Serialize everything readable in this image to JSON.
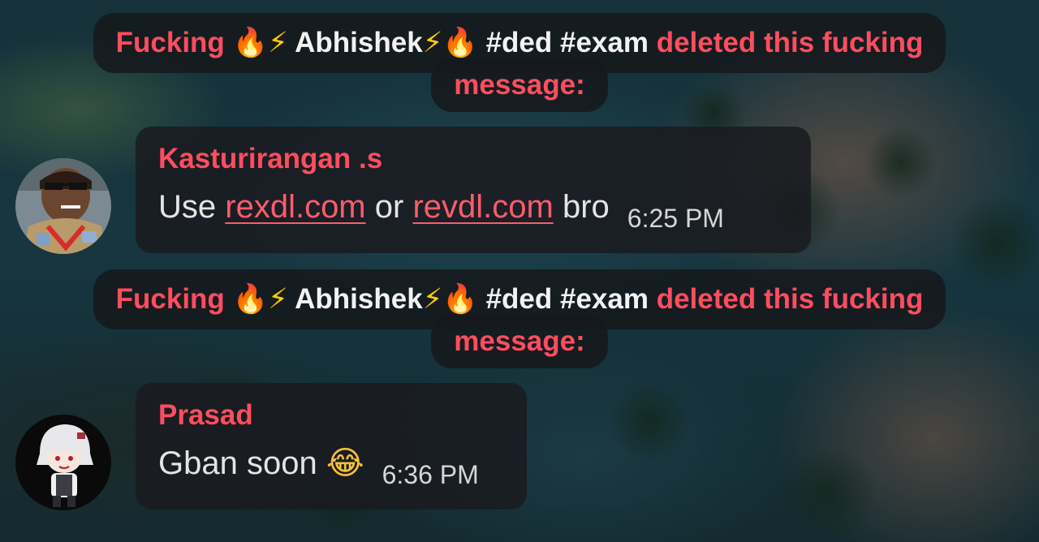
{
  "service_message": {
    "actor_prefix": "Fucking ",
    "fire_emoji": "🔥",
    "bolt_emoji": "⚡",
    "actor_name": " Abhishek",
    "hashtags": " #ded #exam ",
    "action": "deleted this fucking",
    "action_cont": "message:"
  },
  "messages": [
    {
      "sender": "Kasturirangan .s",
      "text_before": "Use ",
      "link1": "rexdl.com",
      "text_mid": " or ",
      "link2": "revdl.com",
      "text_after": " bro",
      "time": "6:25 PM"
    },
    {
      "sender": "Prasad",
      "text": "Gban soon ",
      "emoji": "😂",
      "time": "6:36 PM"
    }
  ],
  "colors": {
    "accent": "#ff4d5e",
    "bubble": "#1a1b1f"
  }
}
